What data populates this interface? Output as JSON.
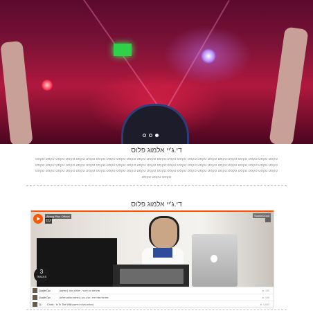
{
  "hero": {
    "slide_count": 3,
    "active_slide": 3
  },
  "section1": {
    "title": "די.ג'יי אלמוג פלוס",
    "body": "טקסט טקסט טקסט טקסט טקסט טקסט טקסט טקסט טקסט טקסט טקסט טקסט טקסט טקסט טקסט טקסט טקסט טקסט טקסט טקסט טקסט טקסט טקסט טקסט טקסט טקסט טקסט טקסט טקסט טקסט טקסט טקסט טקסט טקסט טקסט טקסט טקסט טקסט טקסט טקסט טקסט טקסט טקסט טקסט טקסט טקסט טקסט טקסט טקסט טקסט טקסט טקסט טקסט טקסט טקסט טקסט טקסט טקסט טקסט טקסט טקסט טקסט טקסט טקסט טקסט טקסט טקסט טקסט טקסט טקסט טקסט טקסט טקסט טקסט טקסט"
  },
  "section2": {
    "title": "די.ג'יי אלמוג פלוס"
  },
  "player": {
    "uploader": "Almog Plus Official",
    "set_title": "DJ",
    "logo": "SoundCloud",
    "tracks_count": "3",
    "tracks_label": "TRACKS",
    "tracks": [
      {
        "artist": "Qualle Djo",
        "title": "מחרוזת ים תיכוני - יאללה מהר (רמיקס)",
        "plays": "► 185"
      },
      {
        "artist": "Qualle Djo",
        "title": "מחרוזת מזרחית - ערב טוב (רמיקס אלמוג פלוס)",
        "plays": "► 146"
      },
      {
        "artist": "Dj",
        "title": "Chola - In To The Wild (אלמוג פלוס רמיקס)",
        "plays": "► 4,843"
      }
    ]
  },
  "colors": {
    "accent": "#ff5500",
    "divider": "#bbbbbb"
  }
}
